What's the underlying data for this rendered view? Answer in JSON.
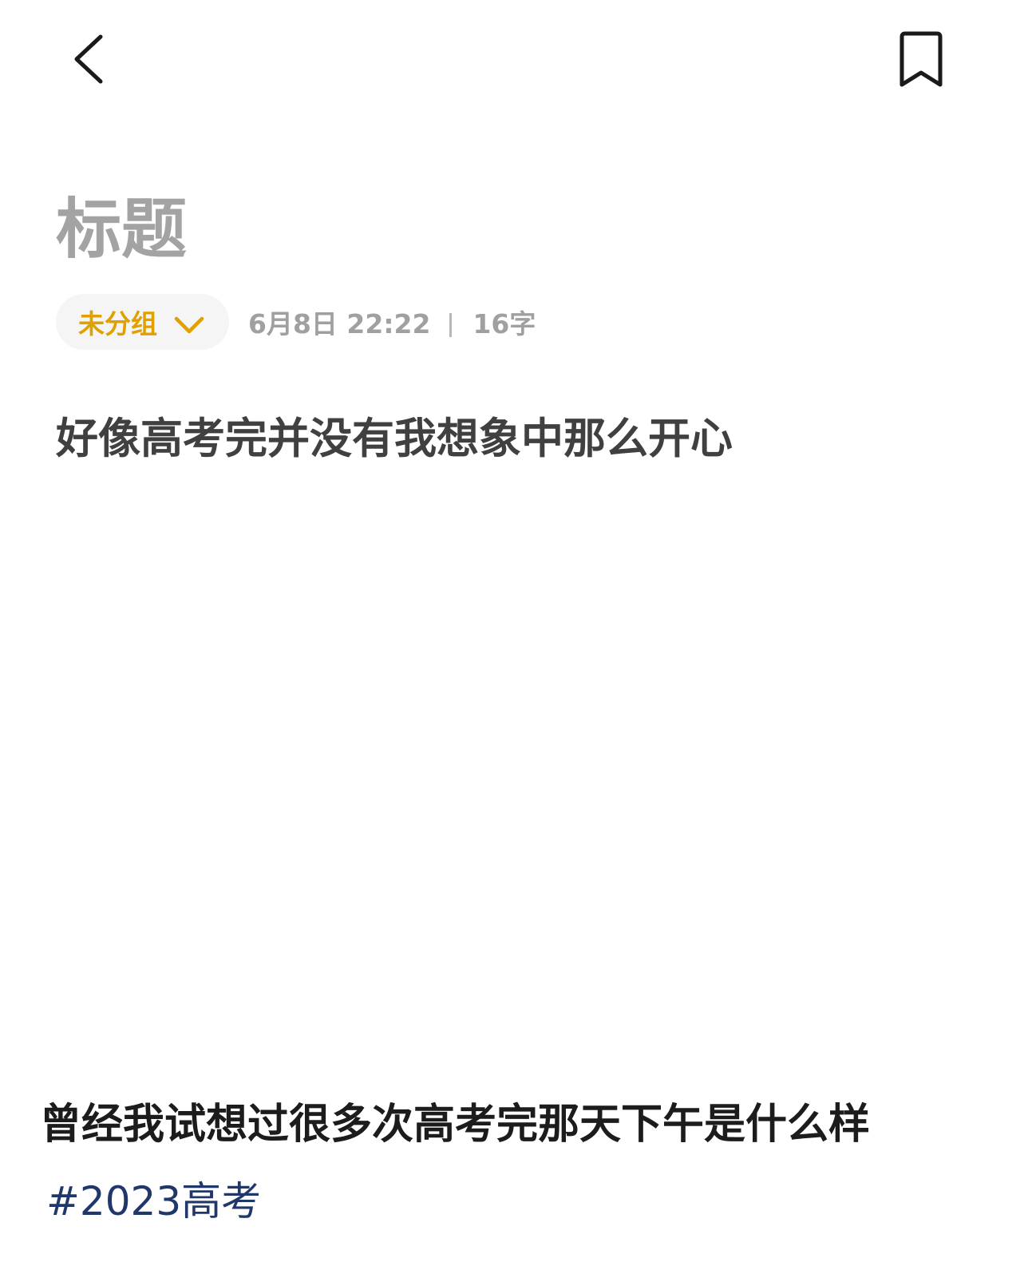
{
  "header": {
    "back_icon": "chevron-left-icon",
    "bookmark_icon": "bookmark-icon"
  },
  "note": {
    "title": "标题",
    "group": {
      "label": "未分组",
      "icon": "chevron-down-icon",
      "color": "#e0a100"
    },
    "date": "6月8日 22:22",
    "word_count": "16字",
    "body": "好像高考完并没有我想象中那么开心"
  },
  "post": {
    "caption": "曾经我试想过很多次高考完那天下午是什么样",
    "hashtag": "#2023高考",
    "hashtag_color": "#20376b"
  }
}
